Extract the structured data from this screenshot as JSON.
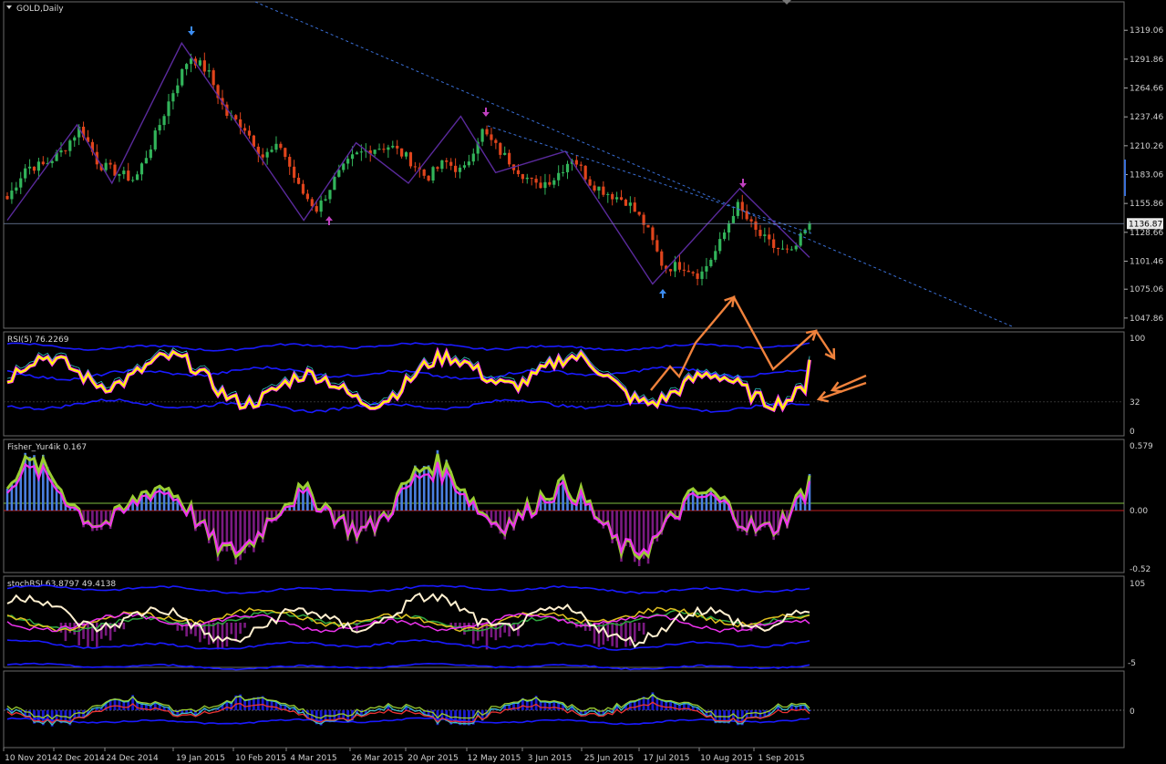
{
  "window": {
    "title": "GOLD,Daily"
  },
  "price_tag": "1136.87",
  "price_axis": [
    "1319.06",
    "1291.86",
    "1264.66",
    "1237.46",
    "1210.26",
    "1183.06",
    "1155.86",
    "1128.66",
    "1101.46",
    "1075.06",
    "1047.86"
  ],
  "date_axis": [
    "10 Nov 2014",
    "2 Dec 2014",
    "24 Dec 2014",
    "19 Jan 2015",
    "10 Feb 2015",
    "4 Mar 2015",
    "26 Mar 2015",
    "20 Apr 2015",
    "12 May 2015",
    "3 Jun 2015",
    "25 Jun 2015",
    "17 Jul 2015",
    "10 Aug 2015",
    "1 Sep 2015"
  ],
  "indicators": {
    "rsi": {
      "label": "RSI(5) 76.2269",
      "scale": [
        "100",
        "32",
        "0"
      ]
    },
    "fisher": {
      "label": "Fisher_Yur4ik 0.167",
      "scale": [
        "0.579",
        "0.00",
        "-0.52"
      ]
    },
    "stoch": {
      "label": "stochRSI 63.8797 49.4138",
      "scale": [
        "105",
        "-5"
      ]
    },
    "panel5": {
      "label": "",
      "scale": [
        "0"
      ]
    }
  },
  "colors": {
    "bull": "#32b45a",
    "bear": "#e0441c",
    "zigzag": "#5a2a9c",
    "trend": "#3a6fd6",
    "annot": "#f0823c",
    "rsi_main": "#ffff00",
    "rsi_outline": "#ff33ff",
    "fisher_line": "#ee33ee",
    "fisher_sig": "#9acd32",
    "hist_pos": "#4a7fe0",
    "hist_neg": "#7a1a80",
    "band": "#1a1aff"
  },
  "chart_data": {
    "type": "candlestick",
    "symbol": "GOLD",
    "timeframe": "Daily",
    "last_price": 1136.87,
    "ylim": [
      1040,
      1333
    ],
    "x": [
      "2014-11-10",
      "2014-11-17",
      "2014-11-24",
      "2014-12-01",
      "2014-12-08",
      "2014-12-15",
      "2014-12-22",
      "2014-12-29",
      "2015-01-05",
      "2015-01-12",
      "2015-01-19",
      "2015-01-26",
      "2015-02-02",
      "2015-02-09",
      "2015-02-16",
      "2015-02-23",
      "2015-03-02",
      "2015-03-09",
      "2015-03-16",
      "2015-03-23",
      "2015-03-30",
      "2015-04-06",
      "2015-04-13",
      "2015-04-20",
      "2015-04-27",
      "2015-05-04",
      "2015-05-11",
      "2015-05-18",
      "2015-05-25",
      "2015-06-01",
      "2015-06-08",
      "2015-06-15",
      "2015-06-22",
      "2015-06-29",
      "2015-07-06",
      "2015-07-13",
      "2015-07-20",
      "2015-07-27",
      "2015-08-03",
      "2015-08-10",
      "2015-08-17",
      "2015-08-24",
      "2015-08-31",
      "2015-09-07",
      "2015-09-14"
    ],
    "close": [
      1160,
      1190,
      1192,
      1205,
      1228,
      1193,
      1185,
      1178,
      1215,
      1258,
      1295,
      1280,
      1240,
      1228,
      1200,
      1210,
      1170,
      1150,
      1180,
      1200,
      1208,
      1210,
      1198,
      1180,
      1195,
      1185,
      1225,
      1205,
      1188,
      1172,
      1180,
      1200,
      1175,
      1165,
      1158,
      1135,
      1095,
      1098,
      1088,
      1115,
      1155,
      1130,
      1115,
      1108,
      1137
    ],
    "zigzag_pivots": [
      [
        0,
        1140
      ],
      [
        4,
        1230
      ],
      [
        6,
        1175
      ],
      [
        10,
        1307
      ],
      [
        17,
        1140
      ],
      [
        20,
        1213
      ],
      [
        23,
        1175
      ],
      [
        26,
        1238
      ],
      [
        28,
        1185
      ],
      [
        32,
        1205
      ],
      [
        37,
        1080
      ],
      [
        42,
        1170
      ],
      [
        46,
        1105
      ]
    ],
    "indicators": {
      "RSI(5)": 76.2269,
      "Fisher_Yur4ik": 0.167,
      "stochRSI": [
        63.8797,
        49.4138
      ]
    }
  }
}
